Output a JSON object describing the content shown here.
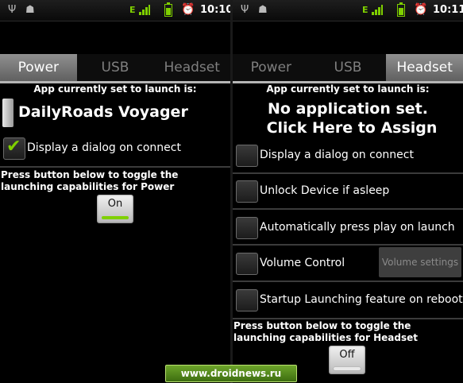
{
  "left": {
    "status": {
      "usb_icon": "usb-icon",
      "debug_icon": "android-debug-icon",
      "network": "E",
      "alarm_icon": "alarm-clock-icon",
      "time": "10:10"
    },
    "tabs": [
      {
        "label": "Power",
        "active": true
      },
      {
        "label": "USB",
        "active": false
      },
      {
        "label": "Headset",
        "active": false
      }
    ],
    "launch_label": "App currently set to launch is:",
    "app_name": "DailyRoads Voyager",
    "checkbox": {
      "label": "Display a dialog on connect",
      "checked": true
    },
    "toggle_text": "Press button below to toggle the launching capabilities for Power",
    "toggle_button": {
      "label": "On",
      "state_color": "#7fd000"
    }
  },
  "right": {
    "status": {
      "usb_icon": "usb-icon",
      "debug_icon": "android-debug-icon",
      "network": "E",
      "alarm_icon": "alarm-clock-icon",
      "time": "10:11"
    },
    "tabs": [
      {
        "label": "Power",
        "active": false
      },
      {
        "label": "USB",
        "active": false
      },
      {
        "label": "Headset",
        "active": true
      }
    ],
    "launch_label": "App currently set to launch is:",
    "no_app_line1": "No application set.",
    "no_app_line2": "Click Here to Assign",
    "options": [
      {
        "label": "Display a dialog on connect",
        "checked": false
      },
      {
        "label": "Unlock Device if asleep",
        "checked": false
      },
      {
        "label": "Automatically press play on launch",
        "checked": false
      },
      {
        "label": "Volume Control",
        "checked": false
      },
      {
        "label": "Startup Launching feature on reboot",
        "checked": false
      }
    ],
    "volume_settings_button": "Volume settings",
    "toggle_text": "Press button below to toggle the launching capabilities for Headset",
    "toggle_button": {
      "label": "Off",
      "state_color": "#e8e8e8"
    }
  },
  "watermark": "www.droidnews.ru"
}
